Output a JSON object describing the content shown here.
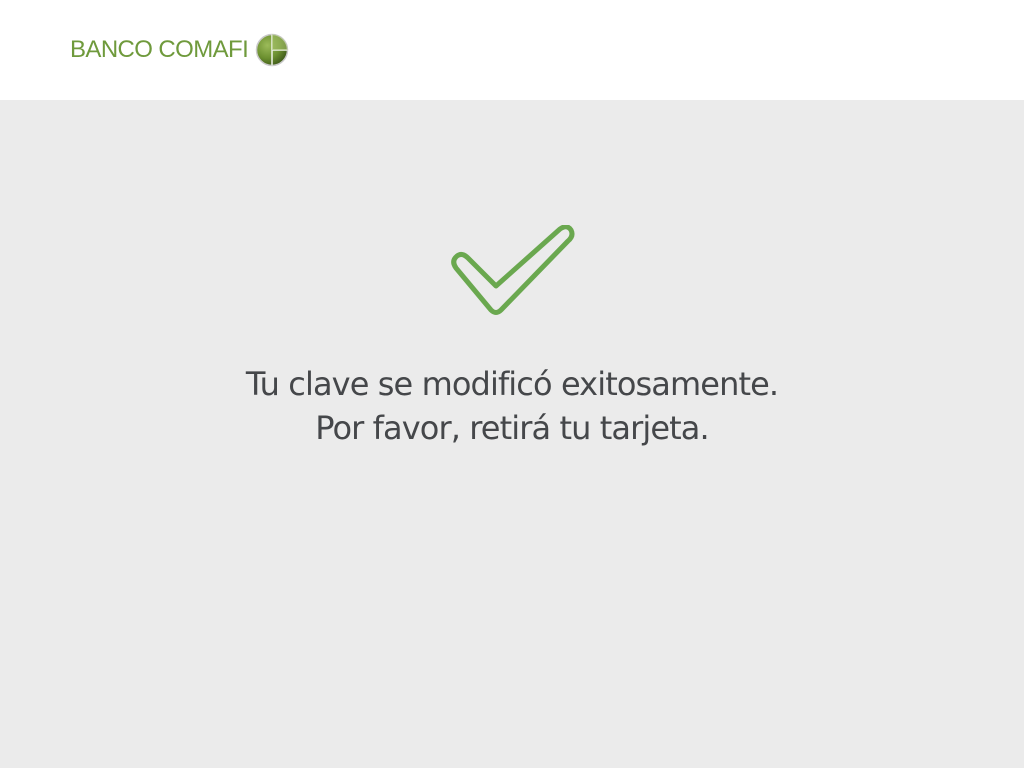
{
  "header": {
    "logo": {
      "text": "BANCO COMAFI",
      "icon": "globe-logo-icon",
      "color": "#6f9a3c"
    }
  },
  "main": {
    "status_icon": "checkmark-icon",
    "status_color": "#6aa84f",
    "message_line1": "Tu clave se modificó exitosamente.",
    "message_line2": "Por favor, retirá tu tarjeta."
  }
}
